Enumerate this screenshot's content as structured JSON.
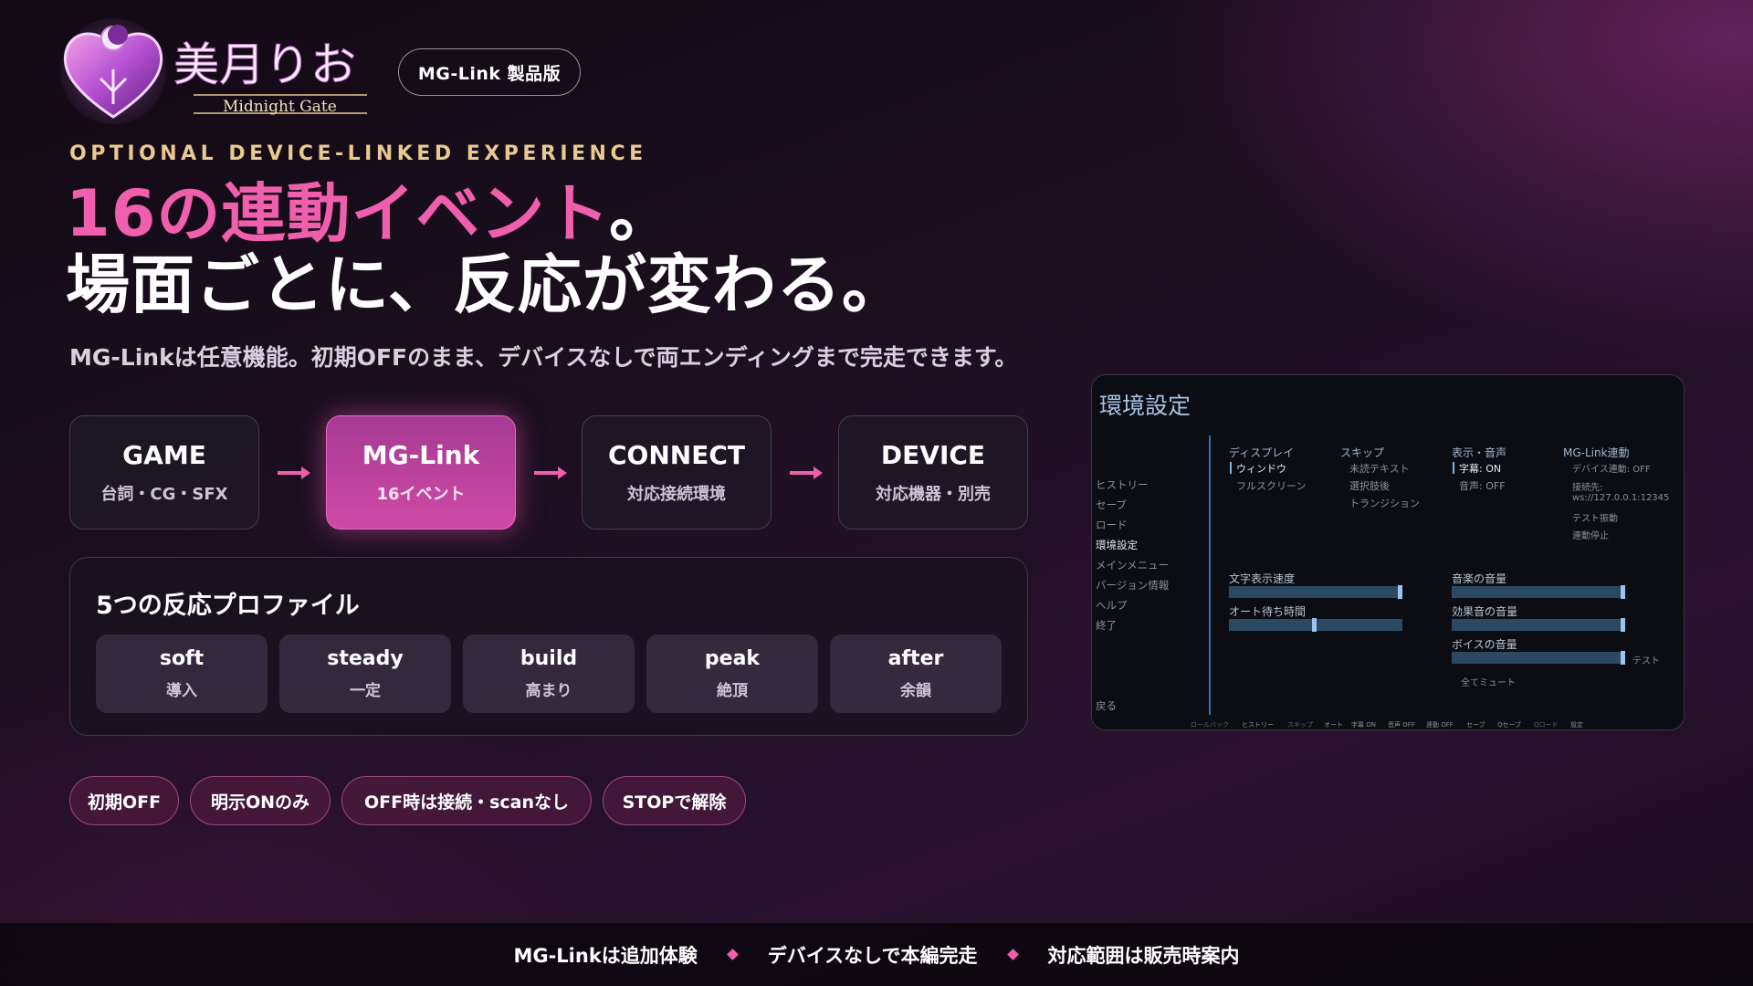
{
  "header": {
    "logo_title": "美月りお",
    "logo_subtitle": "Midnight Gate",
    "badge": "MG-Link 製品版",
    "eyebrow": "OPTIONAL DEVICE-LINKED EXPERIENCE",
    "headline1_pink": "16の連動イベント",
    "headline1_tail": "。",
    "headline2": "場面ごとに、反応が変わる。",
    "subline": "MG-Linkは任意機能。初期OFFのまま、デバイスなしで両エンディングまで完走できます。"
  },
  "flow": [
    {
      "title": "GAME",
      "sub": "台詞・CG・SFX",
      "active": false
    },
    {
      "title": "MG-Link",
      "sub": "16イベント",
      "active": true
    },
    {
      "title": "CONNECT",
      "sub": "対応接続環境",
      "active": false
    },
    {
      "title": "DEVICE",
      "sub": "対応機器・別売",
      "active": false
    }
  ],
  "profiles": {
    "title": "5つの反応プロファイル",
    "items": [
      {
        "name": "soft",
        "sub": "導入"
      },
      {
        "name": "steady",
        "sub": "一定"
      },
      {
        "name": "build",
        "sub": "高まり"
      },
      {
        "name": "peak",
        "sub": "絶頂"
      },
      {
        "name": "after",
        "sub": "余韻"
      }
    ]
  },
  "chips": [
    "初期OFF",
    "明示ONのみ",
    "OFF時は接続・scanなし",
    "STOPで解除"
  ],
  "screenshot": {
    "title": "環境設定",
    "nav": [
      "ヒストリー",
      "セーブ",
      "ロード",
      "環境設定",
      "メインメニュー",
      "バージョン情報",
      "ヘルプ",
      "終了"
    ],
    "nav_current": "環境設定",
    "back": "戻る",
    "columns": [
      {
        "head": "ディスプレイ",
        "options": [
          "ウィンドウ",
          "フルスクリーン"
        ],
        "selected": "ウィンドウ"
      },
      {
        "head": "スキップ",
        "options": [
          "未読テキスト",
          "選択肢後",
          "トランジション"
        ],
        "selected": ""
      },
      {
        "head": "表示・音声",
        "options": [
          "字幕: ON",
          "音声: OFF"
        ],
        "selected": "字幕: ON"
      },
      {
        "head": "MG-Link連動",
        "options": [
          "デバイス連動: OFF",
          "接続先:",
          "ws://127.0.0.1:12345",
          "テスト振動",
          "連動停止"
        ],
        "selected": ""
      }
    ],
    "sliders": [
      {
        "label": "文字表示速度",
        "value": 1.0
      },
      {
        "label": "オート待ち時間",
        "value": 0.49
      },
      {
        "label": "音楽の音量",
        "value": 1.0
      },
      {
        "label": "効果音の音量",
        "value": 1.0
      },
      {
        "label": "ボイスの音量",
        "value": 1.0
      }
    ],
    "voice_test": "テスト",
    "mute_all": "全てミュート",
    "quickmenu": [
      "ロールバック",
      "ヒストリー",
      "スキップ",
      "オート",
      "字幕 ON",
      "音声 OFF",
      "連動 OFF",
      "セーブ",
      "Qセーブ",
      "Qロード",
      "設定"
    ]
  },
  "footer": [
    "MG-Linkは追加体験",
    "デバイスなしで本編完走",
    "対応範囲は販売時案内"
  ],
  "colors": {
    "accent_pink": "#f05fae",
    "eyebrow_gold": "#e8c98f",
    "active_box": "#cf4aa6"
  }
}
